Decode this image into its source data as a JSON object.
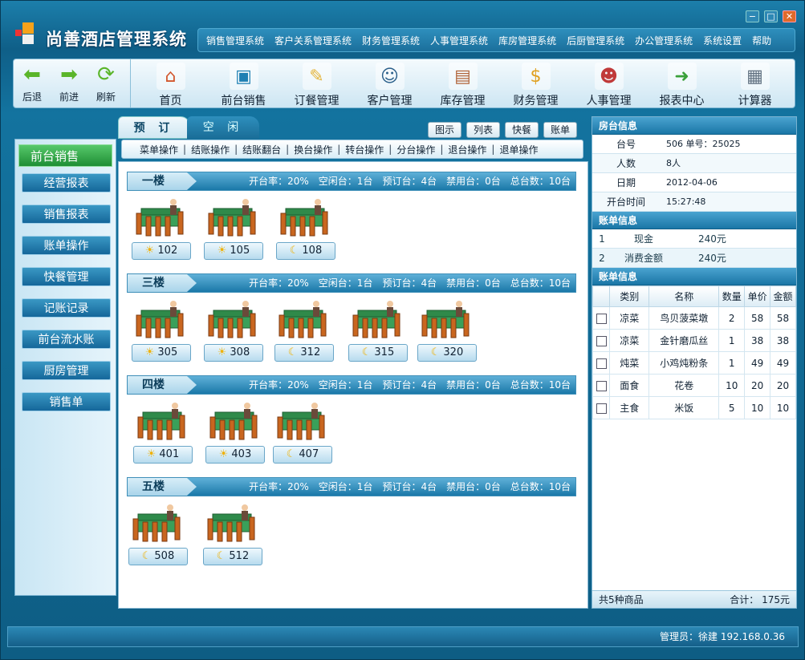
{
  "app": {
    "title": "尚善酒店管理系统"
  },
  "window_controls": [
    "−",
    "□",
    "✕"
  ],
  "top_menu": [
    "销售管理系统",
    "客户关系管理系统",
    "财务管理系统",
    "人事管理系统",
    "库房管理系统",
    "后厨管理系统",
    "办公管理系统",
    "系统设置",
    "帮助"
  ],
  "nav": [
    {
      "label": "后退",
      "icon": "back-arrow-icon",
      "glyph": "⬅",
      "color": "#5ab52a"
    },
    {
      "label": "前进",
      "icon": "forward-arrow-icon",
      "glyph": "➡",
      "color": "#5ab52a"
    },
    {
      "label": "刷新",
      "icon": "refresh-icon",
      "glyph": "⟳",
      "color": "#5ab52a"
    }
  ],
  "modules": [
    {
      "label": "首页",
      "icon": "home-icon",
      "glyph": "⌂",
      "color": "#d2562d"
    },
    {
      "label": "前台销售",
      "icon": "computer-icon",
      "glyph": "▣",
      "color": "#1e7fb3"
    },
    {
      "label": "订餐管理",
      "icon": "notepad-icon",
      "glyph": "✎",
      "color": "#e5b43a"
    },
    {
      "label": "客户管理",
      "icon": "customer-icon",
      "glyph": "☺",
      "color": "#2a5f8a"
    },
    {
      "label": "库存管理",
      "icon": "box-icon",
      "glyph": "▤",
      "color": "#b0643a"
    },
    {
      "label": "财务管理",
      "icon": "finance-icon",
      "glyph": "$",
      "color": "#e0a020"
    },
    {
      "label": "人事管理",
      "icon": "personnel-icon",
      "glyph": "☻",
      "color": "#c03a3a"
    },
    {
      "label": "报表中心",
      "icon": "report-icon",
      "glyph": "➜",
      "color": "#3aa03a"
    },
    {
      "label": "计算器",
      "icon": "calculator-icon",
      "glyph": "▦",
      "color": "#607080"
    }
  ],
  "left": {
    "header": "前台销售",
    "items": [
      "经营报表",
      "销售报表",
      "账单操作",
      "快餐管理",
      "记账记录",
      "前台流水账",
      "厨房管理",
      "销售单"
    ]
  },
  "tabs": [
    "预 订",
    "空 闲"
  ],
  "view_buttons": [
    "图示",
    "列表",
    "快餐",
    "账单"
  ],
  "ops": [
    "菜单操作",
    "结账操作",
    "结账翻台",
    "换台操作",
    "转台操作",
    "分台操作",
    "退台操作",
    "退单操作"
  ],
  "floors": [
    {
      "name": "一楼",
      "stats": [
        "开台率：20%",
        "空闲台：1台",
        "预订台：4台",
        "禁用台：0台",
        "总台数：10台"
      ],
      "tables": [
        {
          "no": "102",
          "state": "sun"
        },
        {
          "no": "105",
          "state": "sun"
        },
        {
          "no": "108",
          "state": "moon"
        }
      ]
    },
    {
      "name": "三楼",
      "stats": [
        "开台率：20%",
        "空闲台：1台",
        "预订台：4台",
        "禁用台：0台",
        "总台数：10台"
      ],
      "tables": [
        {
          "no": "305",
          "state": "sun"
        },
        {
          "no": "308",
          "state": "sun"
        },
        {
          "no": "312",
          "state": "moon"
        },
        {
          "no": "315",
          "state": "moon"
        },
        {
          "no": "320",
          "state": "moon"
        }
      ]
    },
    {
      "name": "四楼",
      "stats": [
        "开台率：20%",
        "空闲台：1台",
        "预订台：4台",
        "禁用台：0台",
        "总台数：10台"
      ],
      "tables": [
        {
          "no": "401",
          "state": "sun"
        },
        {
          "no": "403",
          "state": "sun"
        },
        {
          "no": "407",
          "state": "moon"
        }
      ]
    },
    {
      "name": "五楼",
      "stats": [
        "开台率：20%",
        "空闲台：1台",
        "预订台：4台",
        "禁用台：0台",
        "总台数：10台"
      ],
      "tables": [
        {
          "no": "508",
          "state": "moon"
        },
        {
          "no": "512",
          "state": "moon"
        }
      ]
    }
  ],
  "room_info": {
    "title": "房台信息",
    "rows": [
      {
        "k": "台号",
        "v": "506  单号：25025"
      },
      {
        "k": "人数",
        "v": "8人"
      },
      {
        "k": "日期",
        "v": "2012-04-06"
      },
      {
        "k": "开台时间",
        "v": "15:27:48"
      }
    ]
  },
  "bill_info": {
    "title": "账单信息",
    "rows": [
      {
        "i": "1",
        "k": "现金",
        "v": "240元"
      },
      {
        "i": "2",
        "k": "消费金额",
        "v": "240元"
      }
    ]
  },
  "bill_detail": {
    "title": "账单信息",
    "headers": [
      "",
      "类别",
      "名称",
      "数量",
      "单价",
      "金额"
    ],
    "rows": [
      {
        "cat": "凉菜",
        "name": "鸟贝菠菜墩",
        "qty": "2",
        "price": "58",
        "amt": "58"
      },
      {
        "cat": "凉菜",
        "name": "金针磨瓜丝",
        "qty": "1",
        "price": "38",
        "amt": "38"
      },
      {
        "cat": "炖菜",
        "name": "小鸡炖粉条",
        "qty": "1",
        "price": "49",
        "amt": "49"
      },
      {
        "cat": "面食",
        "name": "花卷",
        "qty": "10",
        "price": "20",
        "amt": "20"
      },
      {
        "cat": "主食",
        "name": "米饭",
        "qty": "5",
        "price": "10",
        "amt": "10"
      }
    ],
    "footer_left": "共5种商品",
    "footer_right": "合计：  175元"
  },
  "status": "管理员：徐建  192.168.0.36"
}
